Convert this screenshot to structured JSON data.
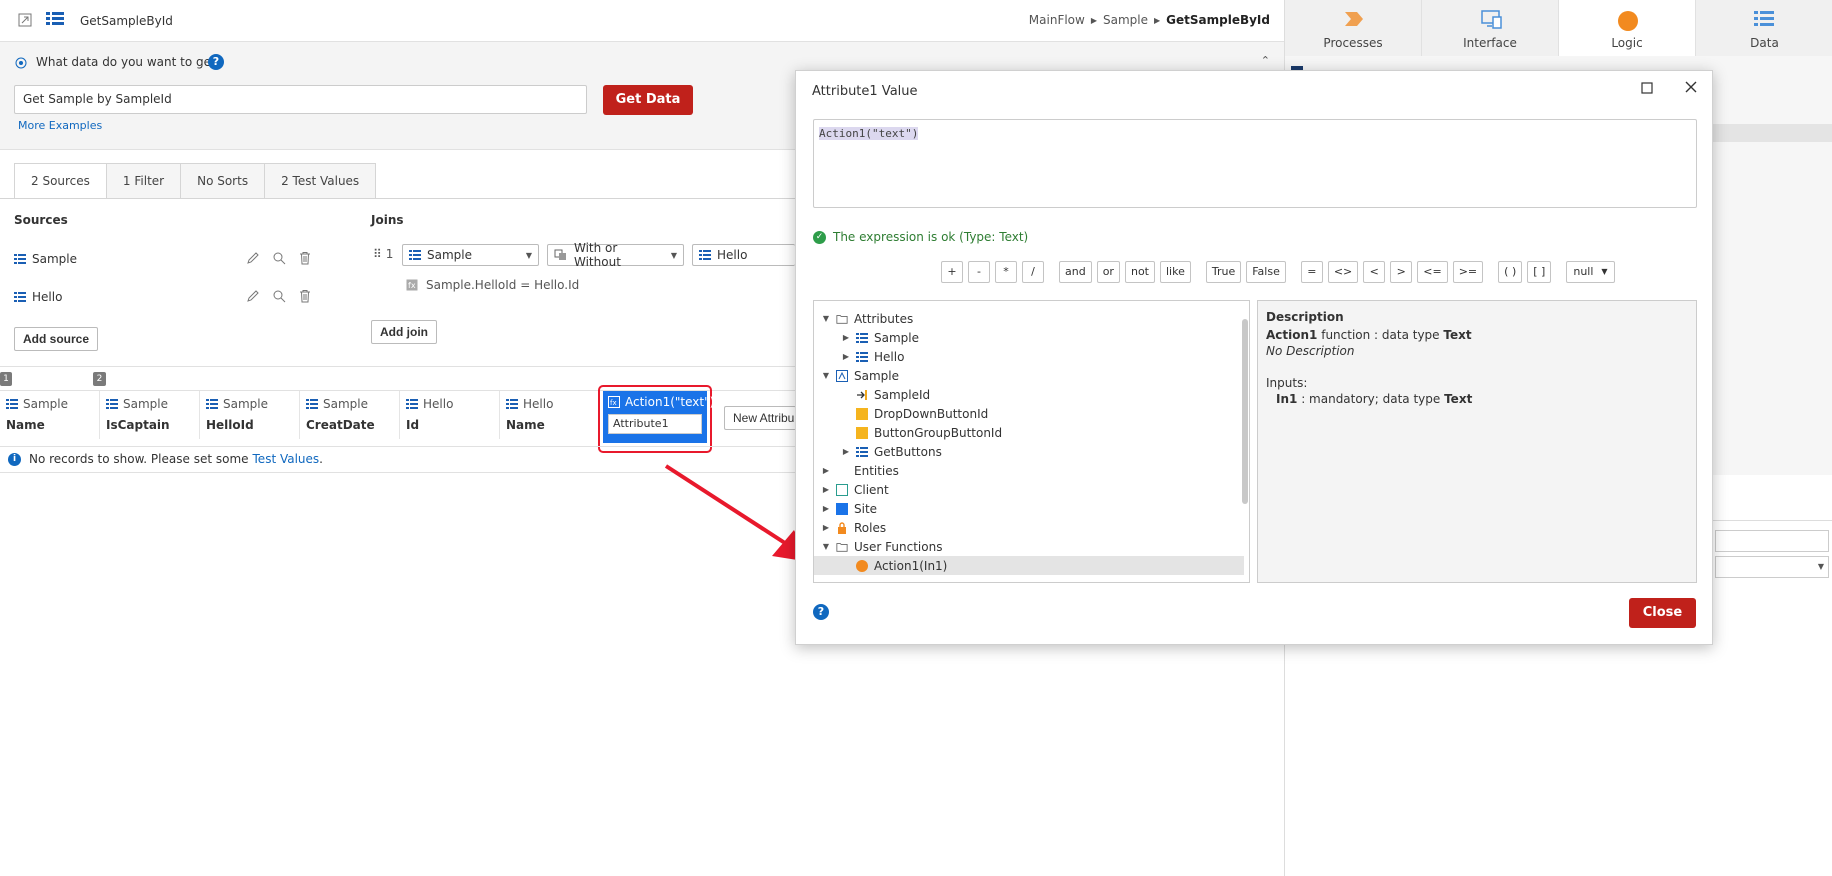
{
  "header": {
    "title": "GetSampleById",
    "breadcrumb": [
      "MainFlow",
      "Sample",
      "GetSampleById"
    ]
  },
  "query": {
    "question": "What data do you want to get?",
    "input_value": "Get Sample by SampleId",
    "get_button": "Get Data",
    "more_examples": "More Examples"
  },
  "tabs": [
    "2 Sources",
    "1 Filter",
    "No Sorts",
    "2 Test Values"
  ],
  "sources": {
    "label": "Sources",
    "items": [
      "Sample",
      "Hello"
    ],
    "add_button": "Add source"
  },
  "joins": {
    "label": "Joins",
    "index": "1",
    "left": "Sample",
    "type": "With or Without",
    "right": "Hello",
    "condition": "Sample.HelloId = Hello.Id",
    "add_button": "Add join"
  },
  "badges": [
    "1",
    "2"
  ],
  "grid": {
    "columns": [
      {
        "entity": "Sample",
        "attr": "Name"
      },
      {
        "entity": "Sample",
        "attr": "IsCaptain"
      },
      {
        "entity": "Sample",
        "attr": "HelloId"
      },
      {
        "entity": "Sample",
        "attr": "CreatDate"
      },
      {
        "entity": "Hello",
        "attr": "Id"
      },
      {
        "entity": "Hello",
        "attr": "Name"
      }
    ],
    "new_col_expr": "Action1(\"text\")",
    "new_col_name": "Attribute1",
    "new_attr_button": "New Attribu",
    "empty_msg": "No records to show. Please set some",
    "empty_link": "Test Values",
    "empty_end": "."
  },
  "right_panel": {
    "tabs": [
      "Processes",
      "Interface",
      "Logic",
      "Data"
    ],
    "active": "Logic"
  },
  "dialog": {
    "title": "Attribute1 Value",
    "expression": "Action1(\"text\")",
    "status": "The expression is ok (Type: Text)",
    "operators_1": [
      "+",
      "-",
      "*",
      "/"
    ],
    "operators_2": [
      "and",
      "or",
      "not",
      "like"
    ],
    "operators_3": [
      "True",
      "False"
    ],
    "operators_4": [
      "=",
      "<>",
      "<",
      ">",
      "<=",
      ">="
    ],
    "operators_5": [
      "( )",
      "[ ]"
    ],
    "null_select": "null",
    "tree": {
      "attributes": "Attributes",
      "attr_sample": "Sample",
      "attr_hello": "Hello",
      "sample": "Sample",
      "sample_id": "SampleId",
      "dropdown": "DropDownButtonId",
      "buttongroup": "ButtonGroupButtonId",
      "getbuttons": "GetButtons",
      "entities": "Entities",
      "client": "Client",
      "site": "Site",
      "roles": "Roles",
      "user_functions": "User Functions",
      "action1": "Action1(In1)"
    },
    "description": {
      "heading": "Description",
      "fn_name": "Action1",
      "fn_mid": "function : data type",
      "fn_type": "Text",
      "no_desc": "No Description",
      "inputs": "Inputs:",
      "in_name": "In1",
      "in_mid": ": mandatory; data type",
      "in_type": "Text"
    },
    "close_button": "Close"
  },
  "colors": {
    "accent_red": "#c0211b",
    "selected_blue": "#1a73e8",
    "highlight_border": "#e8192c",
    "arrow": "#e8192c"
  }
}
